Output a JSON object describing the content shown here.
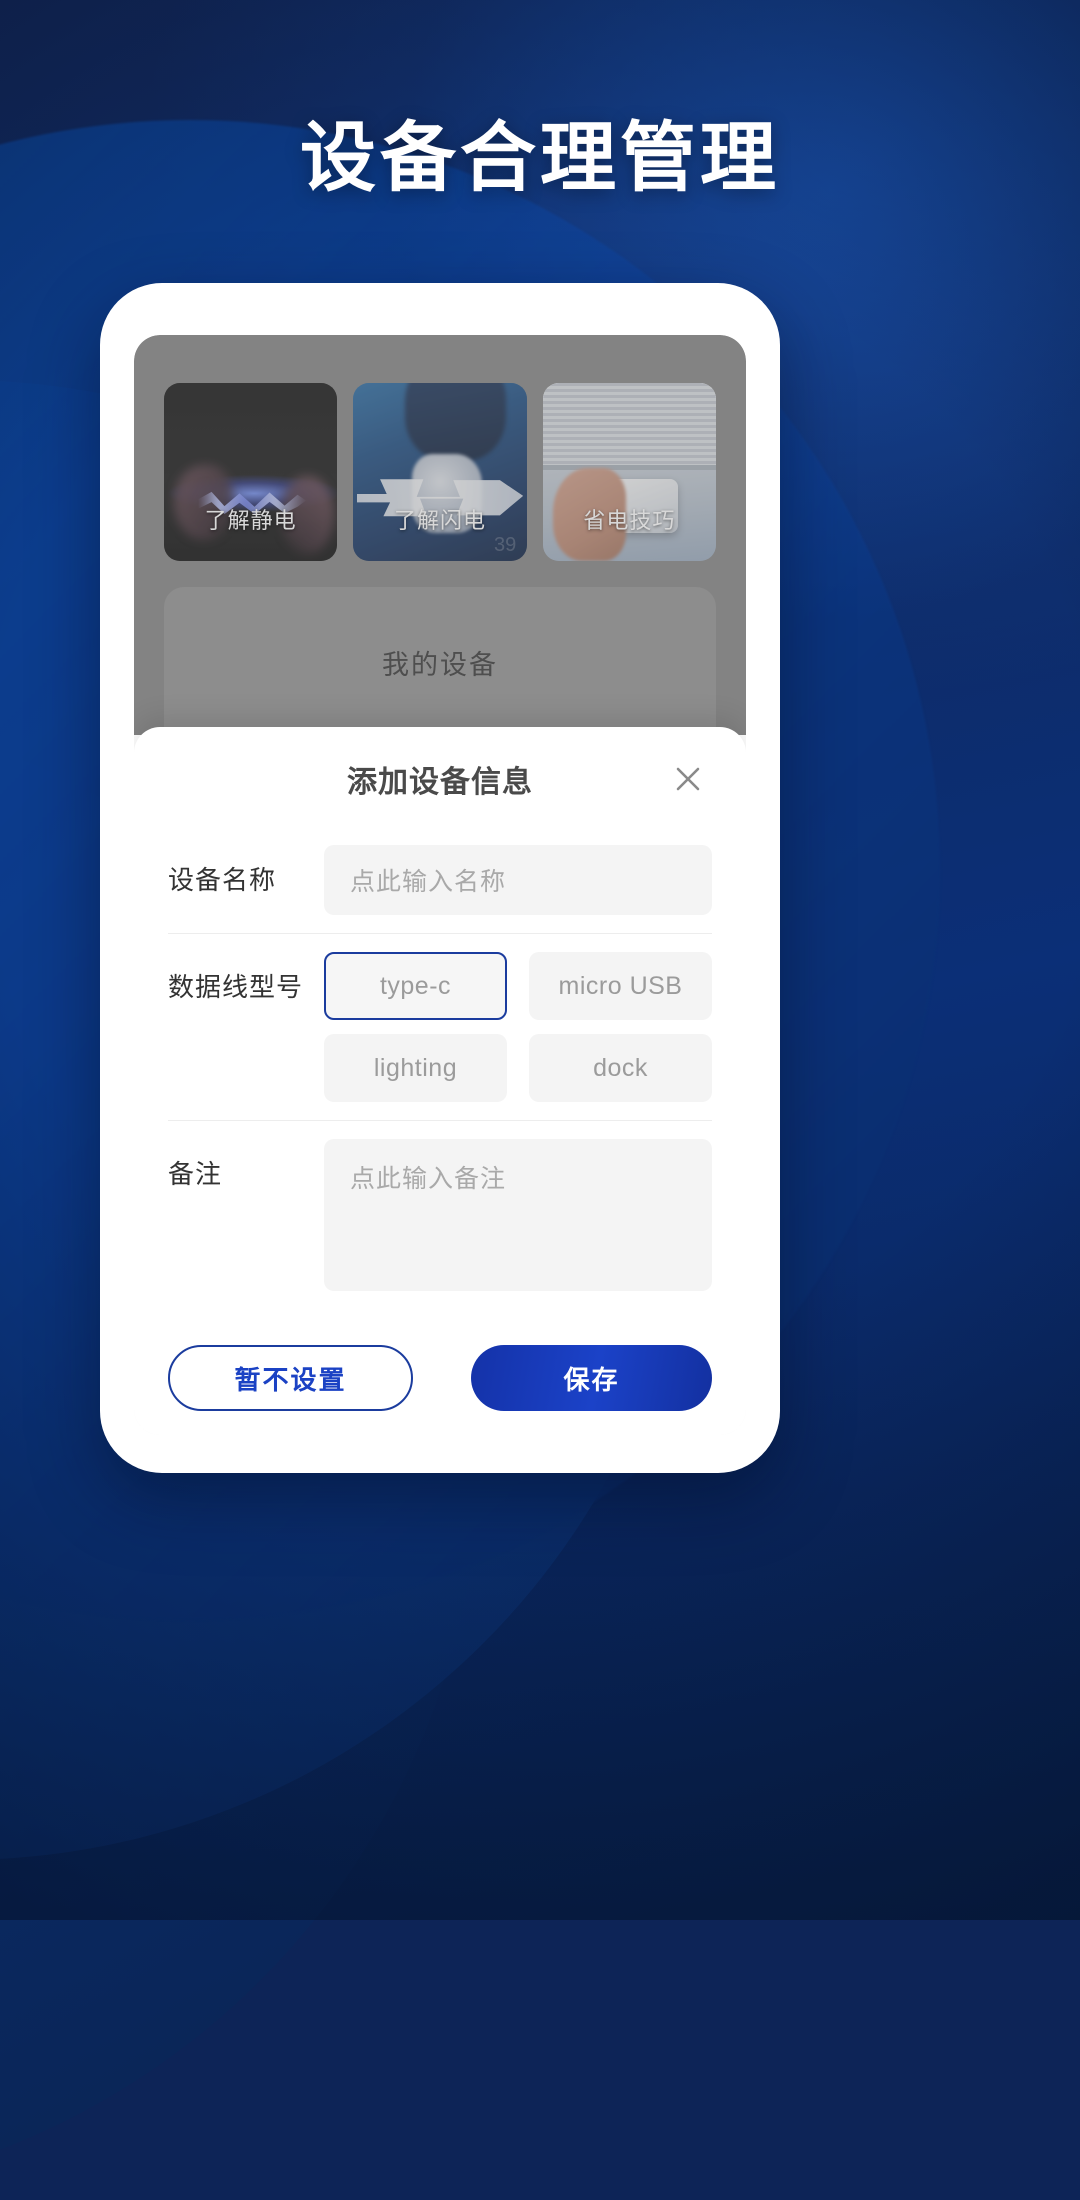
{
  "headline": "设备合理管理",
  "theme": {
    "background_deep": "#0d2457",
    "background_blue": "#0f4fa8",
    "accent": "#1b3c9e",
    "primary_button": "#1b42c8",
    "field_bg": "#f4f4f4",
    "placeholder": "#a9a9a9"
  },
  "app": {
    "tiles": [
      {
        "label": "了解静电",
        "art": "static-electricity-photo"
      },
      {
        "label": "了解闪电",
        "art": "lightning-fist-photo"
      },
      {
        "label": "省电技巧",
        "art": "air-conditioner-remote-photo"
      }
    ],
    "my_device": {
      "title": "我的设备"
    }
  },
  "sheet": {
    "title": "添加设备信息",
    "close_icon": "close-icon",
    "fields": {
      "device_name": {
        "label": "设备名称",
        "placeholder": "点此输入名称",
        "value": ""
      },
      "cable_type": {
        "label": "数据线型号",
        "selected": "type-c",
        "options": [
          "type-c",
          "micro USB",
          "lighting",
          "dock"
        ]
      },
      "remark": {
        "label": "备注",
        "placeholder": "点此输入备注",
        "value": ""
      }
    },
    "actions": {
      "cancel": "暂不设置",
      "save": "保存"
    }
  }
}
